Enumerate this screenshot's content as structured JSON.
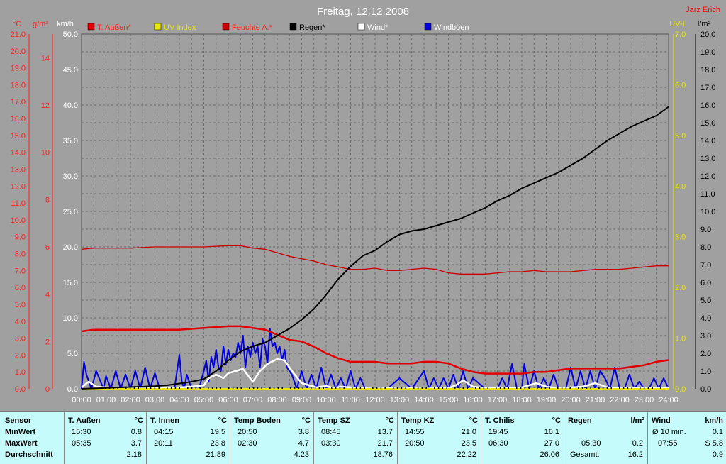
{
  "colors": {
    "background": "#a0a0a0",
    "plot_background": "#a0a0a0",
    "grid": "#6a6a6a",
    "temperature": "#e00000",
    "uv": "#e8e800",
    "humidity": "#cc0000",
    "rain": "#000000",
    "wind": "#ffffff",
    "gusts": "#0000e0",
    "table_bg": "#c6fbfb"
  },
  "header": {
    "title": "Freitag, 12.12.2008",
    "author": "Jarz Erich"
  },
  "axes_labels": {
    "celsius": "°C",
    "gm3": "g/m³",
    "kmh": "km/h",
    "uv": "UV-I",
    "lm2": "l/m²"
  },
  "legend": [
    {
      "label": "T. Außen*",
      "color": "#e00000",
      "textcolor": "#ff2020"
    },
    {
      "label": "UV Index",
      "color": "#e8e800",
      "textcolor": "#e8e800"
    },
    {
      "label": "Feuchte A.*",
      "color": "#cc0000",
      "textcolor": "#ff2020"
    },
    {
      "label": "Regen*",
      "color": "#000000",
      "textcolor": "#000000"
    },
    {
      "label": "Wind*",
      "color": "#ffffff",
      "textcolor": "#ffffff"
    },
    {
      "label": "Windböen",
      "color": "#0000e0",
      "textcolor": "#ffffff"
    }
  ],
  "chart_data": {
    "type": "line",
    "title": "Freitag, 12.12.2008",
    "x_ticks": [
      "00:00",
      "01:00",
      "02:00",
      "03:00",
      "04:00",
      "05:00",
      "06:00",
      "07:00",
      "08:00",
      "09:00",
      "10:00",
      "11:00",
      "12:00",
      "13:00",
      "14:00",
      "15:00",
      "16:00",
      "17:00",
      "18:00",
      "19:00",
      "20:00",
      "21:00",
      "22:00",
      "23:00",
      "24:00"
    ],
    "xlim": [
      0,
      24
    ],
    "axes": {
      "celsius": {
        "ylim": [
          0,
          21
        ],
        "ticks": [
          "0.0",
          "1.0",
          "2.0",
          "3.0",
          "4.0",
          "5.0",
          "6.0",
          "7.0",
          "8.0",
          "9.0",
          "10.0",
          "11.0",
          "12.0",
          "13.0",
          "14.0",
          "15.0",
          "16.0",
          "17.0",
          "18.0",
          "19.0",
          "20.0",
          "21.0"
        ]
      },
      "gm3": {
        "ylim": [
          0,
          15
        ],
        "ticks": [
          "0",
          "2",
          "4",
          "6",
          "8",
          "10",
          "12",
          "14"
        ]
      },
      "kmh": {
        "ylim": [
          0,
          50
        ],
        "ticks": [
          "0.0",
          "5.0",
          "10.0",
          "15.0",
          "20.0",
          "25.0",
          "30.0",
          "35.0",
          "40.0",
          "45.0",
          "50.0"
        ]
      },
      "uv": {
        "ylim": [
          0,
          7
        ],
        "ticks": [
          "0.0",
          "1.0",
          "2.0",
          "3.0",
          "4.0",
          "5.0",
          "6.0",
          "7.0"
        ]
      },
      "lm2": {
        "ylim": [
          0,
          20
        ],
        "ticks": [
          "0.0",
          "1.0",
          "2.0",
          "3.0",
          "4.0",
          "5.0",
          "6.0",
          "7.0",
          "8.0",
          "9.0",
          "10.0",
          "11.0",
          "12.0",
          "13.0",
          "14.0",
          "15.0",
          "16.0",
          "17.0",
          "18.0",
          "19.0",
          "20.0"
        ]
      }
    },
    "series": [
      {
        "name": "T. Außen*",
        "axis": "celsius",
        "x": [
          0,
          0.5,
          1,
          2,
          3,
          4,
          5,
          6,
          6.5,
          7,
          7.5,
          8,
          8.5,
          9,
          9.5,
          10,
          10.5,
          11,
          11.5,
          12,
          12.5,
          13,
          13.5,
          14,
          14.5,
          15,
          15.5,
          16,
          16.5,
          17,
          17.5,
          18,
          18.5,
          19,
          19.5,
          20,
          20.5,
          21,
          21.5,
          22,
          22.5,
          23,
          23.5,
          24
        ],
        "y": [
          3.4,
          3.5,
          3.5,
          3.5,
          3.5,
          3.5,
          3.6,
          3.7,
          3.7,
          3.6,
          3.5,
          3.2,
          2.9,
          2.8,
          2.5,
          2.1,
          1.8,
          1.6,
          1.6,
          1.6,
          1.5,
          1.5,
          1.5,
          1.6,
          1.6,
          1.5,
          1.2,
          1.0,
          0.9,
          0.9,
          0.9,
          0.9,
          1.0,
          1.0,
          1.1,
          1.2,
          1.2,
          1.2,
          1.2,
          1.2,
          1.3,
          1.4,
          1.6,
          1.7
        ]
      },
      {
        "name": "Feuchte A.*",
        "axis": "gm3",
        "x": [
          0,
          0.5,
          1,
          2,
          3,
          4,
          5,
          6,
          6.5,
          7,
          7.5,
          8,
          8.5,
          9,
          9.5,
          10,
          10.5,
          11,
          11.5,
          12,
          12.5,
          13,
          13.5,
          14,
          14.5,
          15,
          15.5,
          16,
          16.5,
          17,
          17.5,
          18,
          18.5,
          19,
          19.5,
          20,
          20.5,
          21,
          21.5,
          22,
          22.5,
          23,
          23.5,
          24
        ],
        "y": [
          5.9,
          5.95,
          5.95,
          5.95,
          6.0,
          6.0,
          6.0,
          6.05,
          6.05,
          5.95,
          5.9,
          5.75,
          5.6,
          5.5,
          5.4,
          5.25,
          5.15,
          5.05,
          5.05,
          5.1,
          5.0,
          5.0,
          5.05,
          5.1,
          5.05,
          4.9,
          4.85,
          4.85,
          4.85,
          4.9,
          4.95,
          4.95,
          5.0,
          4.95,
          4.95,
          4.95,
          5.0,
          5.05,
          5.05,
          5.05,
          5.1,
          5.15,
          5.2,
          5.2
        ]
      },
      {
        "name": "Regen*",
        "axis": "lm2",
        "x": [
          0,
          1,
          2,
          3,
          3.5,
          4,
          4.5,
          5,
          5.5,
          6,
          6.5,
          7,
          7.5,
          8,
          8.5,
          9,
          9.5,
          10,
          10.5,
          11,
          11.5,
          12,
          12.5,
          13,
          13.5,
          14,
          14.5,
          15,
          15.5,
          16,
          16.5,
          17,
          17.5,
          18,
          18.5,
          19,
          19.5,
          20,
          20.5,
          21,
          21.5,
          22,
          22.5,
          23,
          23.5,
          24
        ],
        "y": [
          0.0,
          0.05,
          0.1,
          0.15,
          0.2,
          0.3,
          0.4,
          0.55,
          1.0,
          1.6,
          2.1,
          2.4,
          2.6,
          3.0,
          3.4,
          3.9,
          4.5,
          5.3,
          6.2,
          6.9,
          7.5,
          7.8,
          8.3,
          8.7,
          8.9,
          9.0,
          9.2,
          9.4,
          9.6,
          9.9,
          10.2,
          10.6,
          10.9,
          11.3,
          11.6,
          11.9,
          12.2,
          12.6,
          13.0,
          13.5,
          14.0,
          14.4,
          14.8,
          15.1,
          15.4,
          15.9
        ]
      },
      {
        "name": "Wind*",
        "axis": "kmh",
        "x": [
          0,
          0.3,
          0.6,
          1,
          1.5,
          2,
          2.5,
          3,
          3.5,
          4,
          4.5,
          5,
          5.2,
          5.5,
          5.8,
          6,
          6.3,
          6.6,
          7,
          7.3,
          7.6,
          8,
          8.3,
          8.6,
          9,
          9.3,
          9.6,
          10,
          10.3,
          10.6,
          11,
          11.5,
          12,
          12.5,
          13,
          13.5,
          14,
          14.5,
          15,
          15.3,
          15.6,
          16,
          16.5,
          17,
          17.5,
          18,
          18.3,
          18.6,
          19,
          19.5,
          20,
          20.5,
          21,
          21.5,
          22,
          22.5,
          23,
          23.5,
          24
        ],
        "y": [
          0.2,
          1.0,
          0.3,
          0.2,
          0.1,
          0.1,
          0.3,
          0.2,
          0.1,
          0.2,
          0.3,
          0.5,
          1.5,
          2.0,
          1.5,
          2.2,
          2.5,
          2.8,
          1.0,
          2.5,
          3.5,
          4.2,
          4.0,
          2.5,
          0.8,
          0.5,
          0.2,
          0.4,
          0.1,
          0.3,
          0.2,
          0.1,
          0.0,
          0.1,
          0.0,
          0.1,
          0.0,
          0.1,
          0.1,
          0.5,
          1.2,
          0.3,
          0.1,
          0.2,
          0.1,
          0.2,
          0.5,
          0.8,
          0.3,
          0.1,
          0.2,
          0.3,
          0.8,
          0.2,
          0.1,
          0.2,
          0.1,
          0.1,
          0.2
        ]
      },
      {
        "name": "Windböen",
        "axis": "kmh",
        "x": [
          0,
          0.1,
          0.2,
          0.4,
          0.6,
          0.9,
          1.0,
          1.2,
          1.4,
          1.6,
          1.8,
          2.0,
          2.2,
          2.4,
          2.6,
          2.8,
          3.0,
          3.2,
          3.5,
          3.8,
          4.0,
          4.1,
          4.2,
          4.3,
          4.5,
          4.8,
          5.0,
          5.1,
          5.2,
          5.3,
          5.4,
          5.5,
          5.6,
          5.7,
          5.8,
          5.9,
          6.0,
          6.1,
          6.2,
          6.3,
          6.4,
          6.5,
          6.6,
          6.7,
          6.8,
          6.9,
          7.0,
          7.1,
          7.2,
          7.3,
          7.4,
          7.5,
          7.6,
          7.7,
          7.8,
          7.9,
          8.0,
          8.1,
          8.2,
          8.3,
          8.4,
          8.6,
          8.8,
          9.0,
          9.2,
          9.4,
          9.6,
          9.8,
          10.0,
          10.2,
          10.4,
          10.6,
          10.8,
          11.0,
          11.2,
          11.4,
          11.6,
          12.0,
          12.5,
          13.0,
          13.5,
          14.0,
          14.2,
          14.4,
          14.6,
          14.8,
          15.0,
          15.2,
          15.4,
          15.6,
          15.8,
          16.0,
          16.5,
          17.0,
          17.2,
          17.4,
          17.6,
          17.8,
          18.0,
          18.1,
          18.3,
          18.5,
          18.7,
          18.9,
          19.1,
          19.3,
          19.5,
          19.8,
          20.0,
          20.2,
          20.4,
          20.6,
          20.8,
          21.0,
          21.2,
          21.4,
          21.6,
          21.8,
          22.0,
          22.2,
          22.4,
          22.6,
          22.8,
          23.0,
          23.2,
          23.4,
          23.6,
          23.8,
          24.0
        ],
        "y": [
          0,
          3.8,
          2.0,
          0,
          2.5,
          0,
          1.8,
          0,
          2.5,
          0,
          2.0,
          0,
          2.5,
          0,
          3.0,
          0,
          2.2,
          0,
          0,
          0,
          4.8,
          1.0,
          0,
          2.0,
          0,
          0,
          2.5,
          4.0,
          1.0,
          4.5,
          3.0,
          5.5,
          3.0,
          2.5,
          6.0,
          3.5,
          5.5,
          4.0,
          5.0,
          4.5,
          6.5,
          5.0,
          7.5,
          3.0,
          6.0,
          4.5,
          6.5,
          5.0,
          6.0,
          3.0,
          7.0,
          6.0,
          3.5,
          8.5,
          6.0,
          6.5,
          5.0,
          6.0,
          4.0,
          5.5,
          3.0,
          2.0,
          0,
          2.5,
          0,
          2.0,
          0,
          3.0,
          0,
          2.0,
          0,
          1.5,
          0,
          2.5,
          0,
          1.5,
          0,
          0,
          0,
          1.5,
          0,
          2.5,
          0,
          1.5,
          0,
          1.5,
          0,
          2.0,
          0,
          2.5,
          0,
          1.5,
          0,
          0,
          1.5,
          0,
          3.5,
          0,
          0,
          3.5,
          0,
          2.5,
          0,
          1.5,
          0,
          2.0,
          0,
          0,
          3.0,
          0,
          2.5,
          0,
          2.5,
          0,
          2.5,
          1.5,
          0,
          3.0,
          0,
          0,
          2.0,
          0,
          1.0,
          0,
          0,
          1.5,
          0,
          1.5,
          0
        ]
      },
      {
        "name": "UV Index",
        "axis": "uv",
        "x": [
          0,
          24
        ],
        "y": [
          0,
          0
        ]
      }
    ]
  },
  "table": {
    "row_labels": {
      "sensor": "Sensor",
      "min": "MinWert",
      "max": "MaxWert",
      "avg": "Durchschnitt"
    },
    "columns": [
      {
        "title": "T. Außen",
        "unit": "°C",
        "min_time": "15:30",
        "min_val": "0.8",
        "max_time": "05:35",
        "max_val": "3.7",
        "avg": "2.18"
      },
      {
        "title": "T. Innen",
        "unit": "°C",
        "min_time": "04:15",
        "min_val": "19.5",
        "max_time": "20:11",
        "max_val": "23.8",
        "avg": "21.89"
      },
      {
        "title": "Temp Boden",
        "unit": "°C",
        "min_time": "20:50",
        "min_val": "3.8",
        "max_time": "02:30",
        "max_val": "4.7",
        "avg": "4.23"
      },
      {
        "title": "Temp SZ",
        "unit": "°C",
        "min_time": "08:45",
        "min_val": "13.7",
        "max_time": "03:30",
        "max_val": "21.7",
        "avg": "18.76"
      },
      {
        "title": "Temp KZ",
        "unit": "°C",
        "min_time": "14:55",
        "min_val": "21.0",
        "max_time": "20:50",
        "max_val": "23.5",
        "avg": "22.22"
      },
      {
        "title": "T. Chilis",
        "unit": "°C",
        "min_time": "19:45",
        "min_val": "16.1",
        "max_time": "06:30",
        "max_val": "27.0",
        "avg": "26.06"
      }
    ],
    "rain": {
      "title": "Regen",
      "unit": "l/m²",
      "max_time": "05:30",
      "max_val": "0.2",
      "total_label": "Gesamt:",
      "total": "16.2"
    },
    "wind": {
      "title": "Wind",
      "unit": "km/h",
      "min_label": "Ø 10 min.",
      "min_val": "0.1",
      "max_time": "07:55",
      "max_val": "S 5.8",
      "avg": "0.9"
    }
  }
}
